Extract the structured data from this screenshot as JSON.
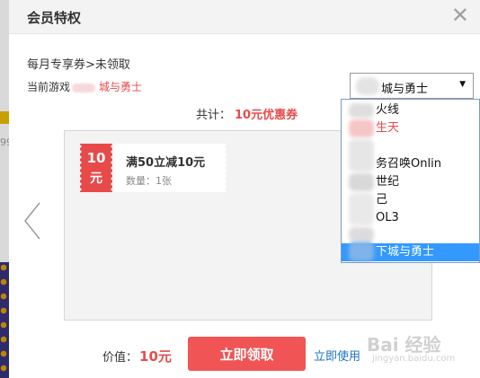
{
  "dialog": {
    "title": "会员特权",
    "close_glyph": "✕",
    "breadcrumb": "每月专享券>未领取",
    "current_game_label": "当前游戏",
    "current_game_name": "城与勇士",
    "select": {
      "selected_value": "城与勇士",
      "arrow": "▼"
    },
    "total": {
      "label": "共计：",
      "value": "10元优惠券"
    },
    "coupon": {
      "amount": "10",
      "unit": "元",
      "condition": "满50立减10元",
      "quantity": "数量：1张"
    },
    "footer": {
      "value_label": "价值：",
      "value_amount": "10元",
      "claim_button": "立即领取",
      "use_link": "立即使用"
    },
    "dropdown": {
      "items": [
        {
          "label": "火线",
          "style": "normal"
        },
        {
          "label": "生天",
          "style": "red"
        },
        {
          "label": "",
          "style": "normal"
        },
        {
          "label": "务召唤Onlin",
          "style": "normal"
        },
        {
          "label": "世纪",
          "style": "normal"
        },
        {
          "label": "己",
          "style": "normal"
        },
        {
          "label": "OL3",
          "style": "normal"
        },
        {
          "label": "",
          "style": "normal"
        },
        {
          "label": "下城与勇士",
          "style": "selected"
        }
      ]
    },
    "backdrop_text": "99",
    "watermark": {
      "main": "Bai 经验",
      "sub": "jingyan.baidu.com"
    },
    "colors": {
      "accent_red": "#e84a4a",
      "button_red": "#f05454",
      "link_blue": "#1a73c9",
      "selected_blue": "#3399ff"
    }
  }
}
